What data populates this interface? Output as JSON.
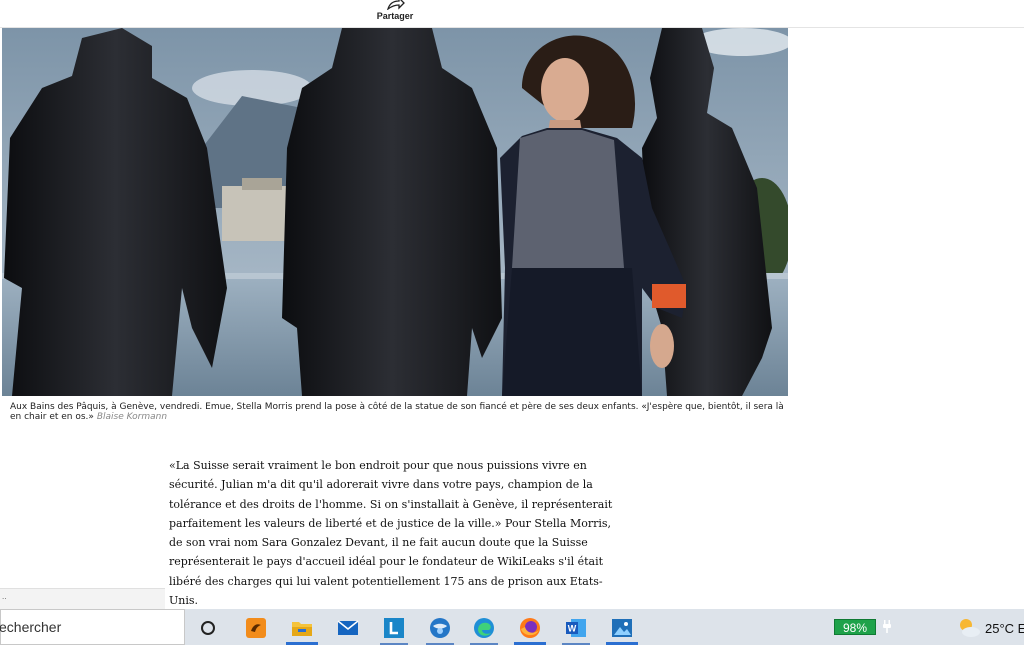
{
  "header": {
    "share_label": "Partager"
  },
  "photo": {
    "alt": ""
  },
  "caption": {
    "text": "Aux Bains des Pâquis, à Genève, vendredi. Emue, Stella Morris prend la pose à côté de la statue de son fiancé et père de ses deux enfants. «J'espère que, bientôt, il sera là en chair et en os.»",
    "credit": "Blaise Kormann"
  },
  "article": {
    "paragraph": "«La Suisse serait vraiment le bon endroit pour que nous puissions vivre en sécurité. Julian m'a dit qu'il adorerait vivre dans votre pays, champion de la tolérance et des droits de l'homme. Si on s'installait à Genève, il représenterait parfaitement les valeurs de liberté et de justice de la ville.» Pour Stella Morris, de son vrai nom Sara Gonzalez Devant, il ne fait aucun doute que la Suisse représenterait le pays d'accueil idéal pour le fondateur de WikiLeaks s'il était libéré des charges qui lui valent potentiellement 175 ans de prison aux Etats-Unis."
  },
  "panel": {
    "text": ".."
  },
  "taskbar": {
    "search_placeholder": "echercher",
    "battery": "98%",
    "weather_temp": "25°C",
    "weather_extra": "E",
    "icons": [
      "task-view-icon",
      "app-orange-icon",
      "file-explorer-icon",
      "mail-icon",
      "l-app-icon",
      "globe-app-icon",
      "edge-icon",
      "firefox-icon",
      "word-icon",
      "photos-icon"
    ]
  }
}
